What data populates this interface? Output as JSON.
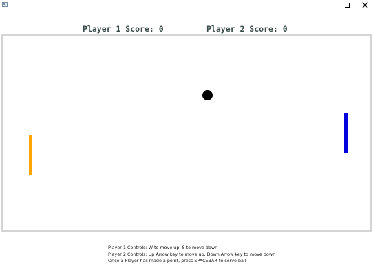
{
  "window": {
    "controls": {
      "minimize_icon": "minimize-icon",
      "maximize_icon": "maximize-icon",
      "close_icon": "close-icon"
    }
  },
  "scoreboard": {
    "player1": "Player 1 Score: 0",
    "player2": "Player 2 Score: 0"
  },
  "colors": {
    "left_paddle": "#FFA500",
    "right_paddle": "#0000DD",
    "ball": "#000000",
    "court_border": "#D4D4D4"
  },
  "instructions": {
    "line1": "Player 1 Controls: W to move up, S to move down",
    "line2": "Player 2 Controls: Up Arrow key to move up, Down Arrow key to move down",
    "line3": "Once a Player has made a point, press SPACEBAR to serve ball"
  }
}
